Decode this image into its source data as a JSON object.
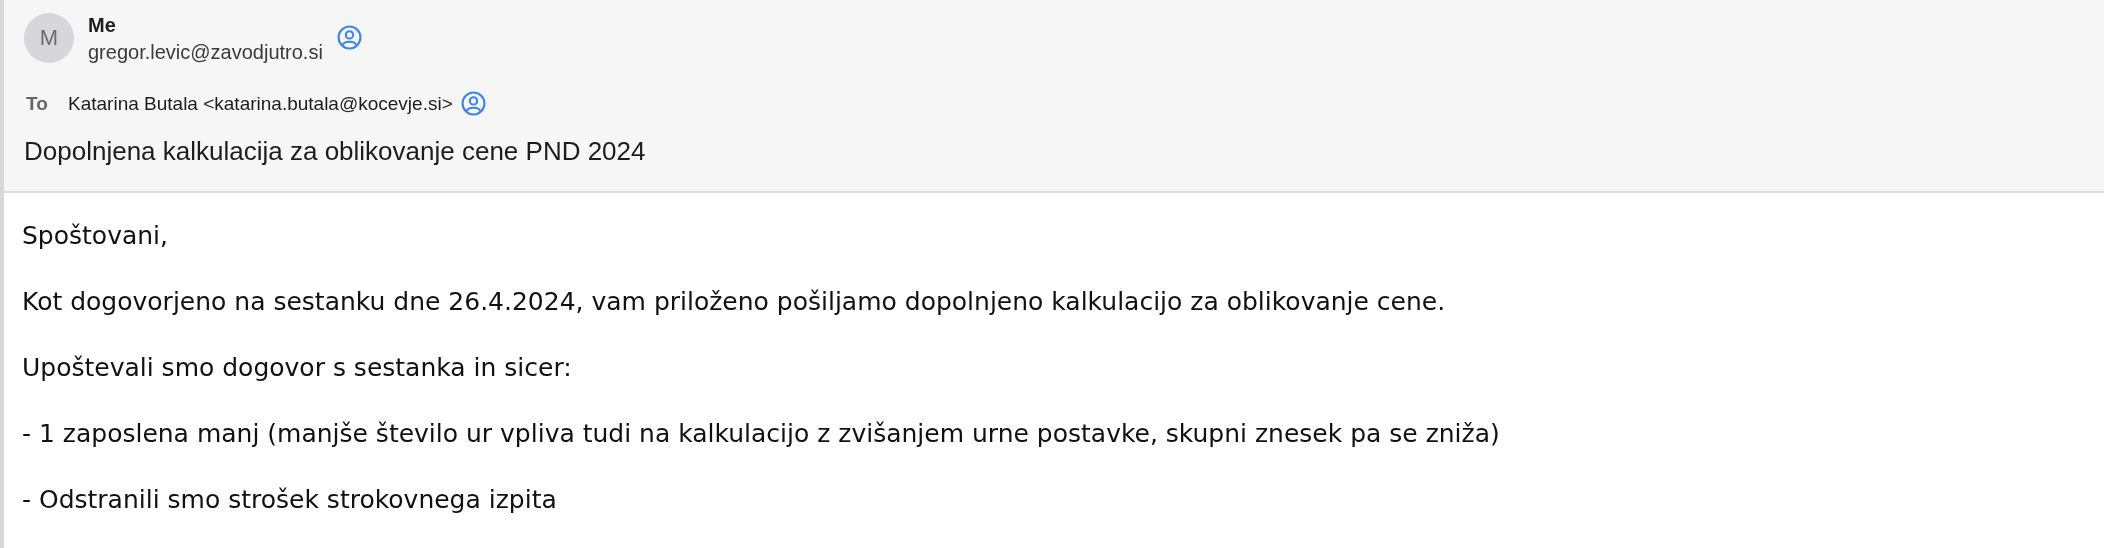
{
  "sender": {
    "avatar_letter": "M",
    "name": "Me",
    "email": "gregor.levic@zavodjutro.si"
  },
  "to": {
    "label": "To",
    "recipient": "Katarina Butala <katarina.butala@kocevje.si>"
  },
  "subject": "Dopolnjena kalkulacija za oblikovanje cene PND 2024",
  "body": [
    "Spoštovani,",
    "Kot dogovorjeno na sestanku dne 26.4.2024, vam priloženo pošiljamo dopolnjeno kalkulacijo za oblikovanje cene.",
    "Upoštevali smo dogovor s sestanka in sicer:",
    "- 1 zaposlena manj (manjše število ur vpliva tudi na kalkulacijo z zvišanjem urne postavke, skupni znesek pa se zniža)",
    "- Odstranili smo strošek strokovnega izpita"
  ]
}
